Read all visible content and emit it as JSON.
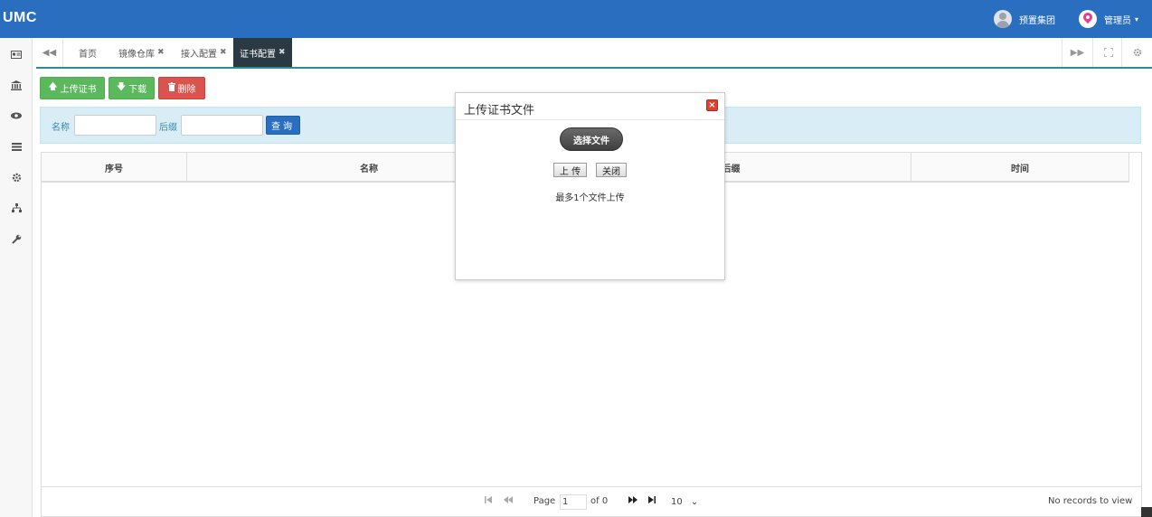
{
  "app": {
    "brand": "UMC"
  },
  "topbar": {
    "org_name": "预置集团",
    "user_name": "管理员",
    "user_caret": "▾"
  },
  "sidebar": {
    "icons": [
      "id-card-icon",
      "bank-icon",
      "eye-icon",
      "list-icon",
      "gear-icon",
      "sitemap-icon",
      "wrench-icon"
    ]
  },
  "tabs": {
    "items": [
      {
        "label": "首页",
        "closable": false,
        "active": false
      },
      {
        "label": "镜像仓库",
        "closable": true,
        "active": false
      },
      {
        "label": "接入配置",
        "closable": true,
        "active": false
      },
      {
        "label": "证书配置",
        "closable": true,
        "active": true
      }
    ],
    "close_glyph": "✖"
  },
  "toolbar": {
    "upload_label": "上传证书",
    "download_label": "下载",
    "delete_label": "删除"
  },
  "search": {
    "name_label": "名称",
    "suffix_label": "后缀",
    "query_label": "查询",
    "name_value": "",
    "suffix_value": ""
  },
  "grid": {
    "columns": [
      "序号",
      "名称",
      "后缀",
      "时间"
    ],
    "rows": []
  },
  "pager": {
    "page_label": "Page",
    "page_value": "1",
    "of_label": "of 0",
    "page_size": "10",
    "records_text": "No records to view"
  },
  "modal": {
    "title": "上传证书文件",
    "choose_label": "选择文件",
    "upload_label": "上 传",
    "close_label": "关闭",
    "note": "最多1个文件上传"
  },
  "colors": {
    "topbar": "#2a6fbf",
    "success": "#5cb85c",
    "danger": "#d9534f",
    "info_panel": "#d9edf7",
    "active_tab": "#2b3a42"
  }
}
